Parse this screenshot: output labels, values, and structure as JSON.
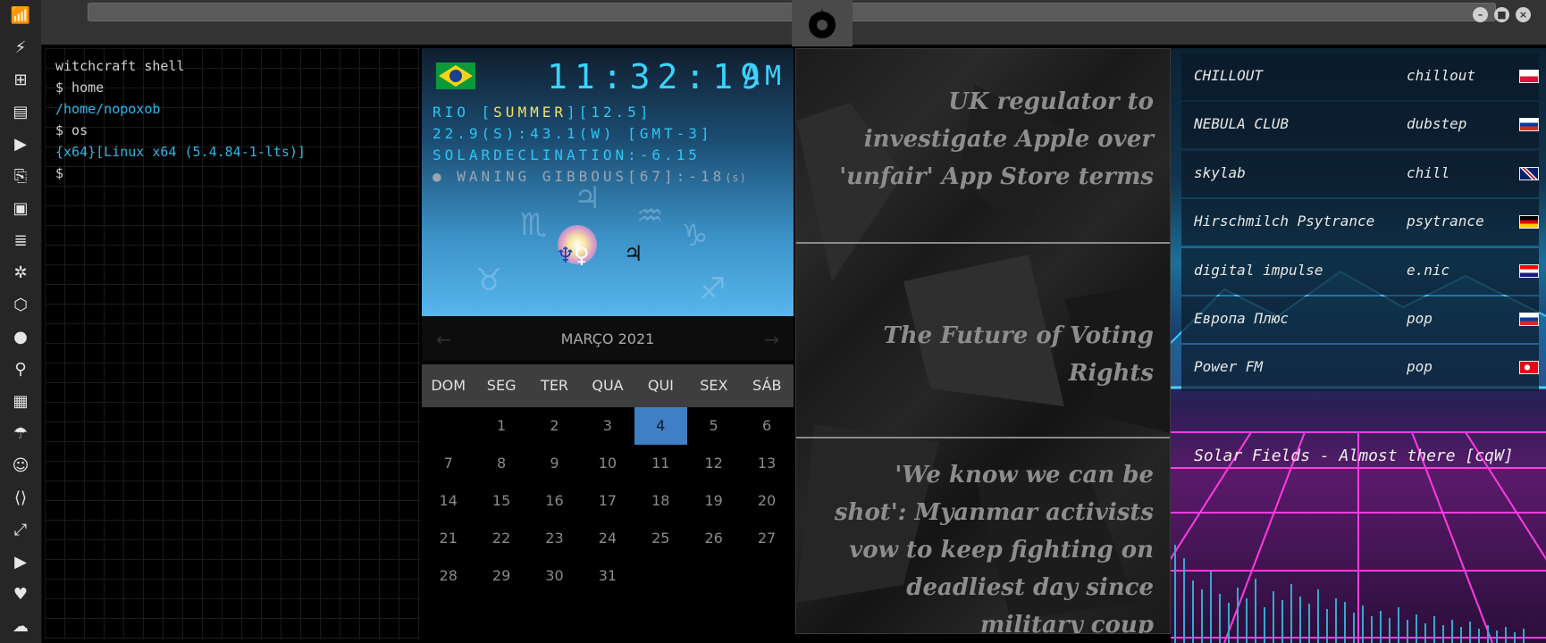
{
  "rail": {
    "icons": [
      "wifi-icon",
      "bolt-icon",
      "windows-icon",
      "archive-icon",
      "play-icon",
      "translate-icon",
      "image-icon",
      "newspaper-icon",
      "snowflake-icon",
      "network-icon",
      "globe-icon",
      "search-icon",
      "map-icon",
      "umbrella-icon",
      "contacts-icon",
      "code-icon",
      "expand-icon",
      "youtube-icon",
      "heart-icon",
      "cloud-icon"
    ]
  },
  "terminal": {
    "lines": [
      {
        "text": "witchcraft shell",
        "color": "white"
      },
      {
        "text": "$ home",
        "color": "white"
      },
      {
        "text": "/home/nopoxob",
        "color": "cyan"
      },
      {
        "text": "$ os",
        "color": "white"
      },
      {
        "text": "{x64}[Linux x64 (5.4.84-1-lts)]",
        "color": "cyan"
      },
      {
        "text": "$",
        "color": "white"
      }
    ]
  },
  "clock": {
    "time": "11:32:19",
    "ampm": "AM",
    "city_prefix": "RIO [",
    "season": "SUMMER",
    "city_suffix": "][12.5]",
    "coords": "22.9(S):43.1(W) [GMT-3]",
    "declination": "SOLARDECLINATION:-6.15",
    "moon": "WANING GIBBOUS[67]:-18",
    "moon_unit": "(s)"
  },
  "calendar": {
    "month": "MARÇO 2021",
    "days_of_week": [
      "DOM",
      "SEG",
      "TER",
      "QUA",
      "QUI",
      "SEX",
      "SÁB"
    ],
    "weeks": [
      [
        "",
        "1",
        "2",
        "3",
        "4",
        "5",
        "6"
      ],
      [
        "7",
        "8",
        "9",
        "10",
        "11",
        "12",
        "13"
      ],
      [
        "14",
        "15",
        "16",
        "17",
        "18",
        "19",
        "20"
      ],
      [
        "21",
        "22",
        "23",
        "24",
        "25",
        "26",
        "27"
      ],
      [
        "28",
        "29",
        "30",
        "31",
        "",
        "",
        ""
      ]
    ],
    "today": "4"
  },
  "news": {
    "headlines": [
      "UK regulator to investigate Apple over 'unfair' App Store terms",
      "The Future of Voting Rights",
      "'We know we can be shot': Myanmar activists vow to keep fighting on deadliest day since military coup"
    ]
  },
  "radio": {
    "stations": [
      {
        "name": "CHILLOUT",
        "genre": "chillout",
        "flag": "poland"
      },
      {
        "name": "NEBULA CLUB",
        "genre": "dubstep",
        "flag": "russia"
      },
      {
        "name": "skylab",
        "genre": "chill",
        "flag": "uk"
      },
      {
        "name": "Hirschmilch Psytrance",
        "genre": "psytrance",
        "flag": "germany"
      },
      {
        "name": "digital impulse",
        "genre": "e.nic",
        "flag": "croatia"
      },
      {
        "name": "Европа Плюс",
        "genre": "pop",
        "flag": "russia"
      },
      {
        "name": "Power FM",
        "genre": "pop",
        "flag": "turkey"
      }
    ],
    "now_playing": "Solar Fields - Almost there [cqW]"
  }
}
